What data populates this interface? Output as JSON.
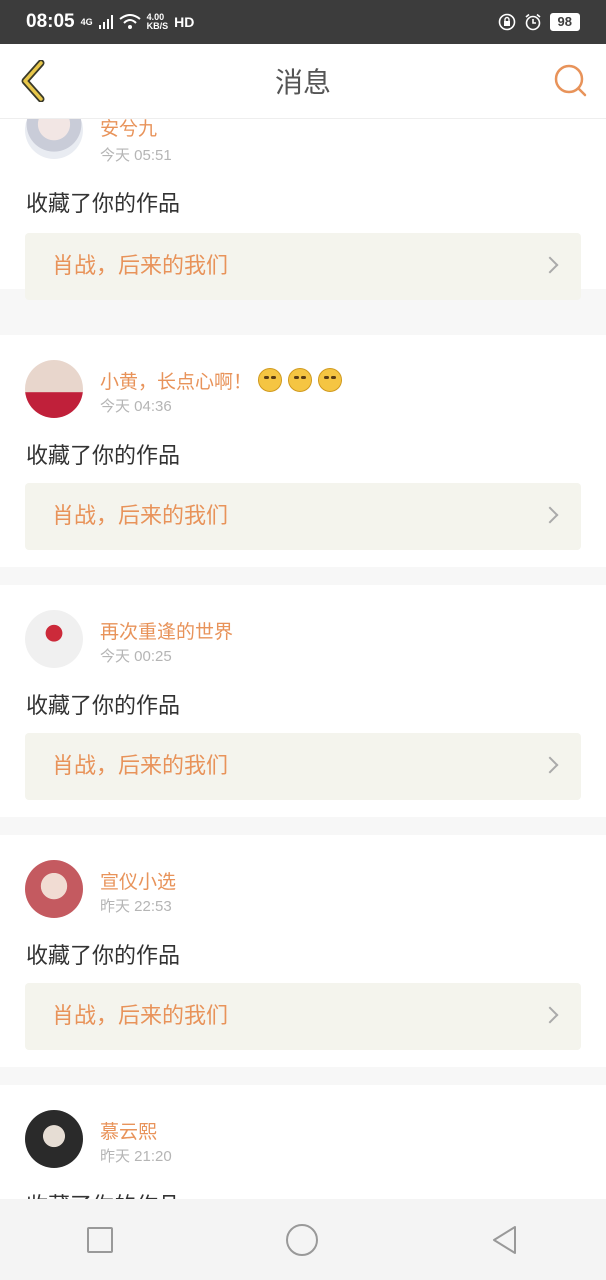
{
  "status_bar": {
    "time": "08:05",
    "network": "4G",
    "speed_value": "4.00",
    "speed_unit": "KB/S",
    "hd": "HD",
    "battery": "98"
  },
  "header": {
    "title": "消息"
  },
  "messages": [
    {
      "name": "安兮九",
      "time": "今天 05:51",
      "action": "收藏了你的作品",
      "work": "肖战，后来的我们"
    },
    {
      "name": "小黄，长点心啊！",
      "time": "今天 04:36",
      "action": "收藏了你的作品",
      "work": "肖战，后来的我们"
    },
    {
      "name": "再次重逢的世界",
      "time": "今天 00:25",
      "action": "收藏了你的作品",
      "work": "肖战，后来的我们"
    },
    {
      "name": "宣仪小选",
      "time": "昨天 22:53",
      "action": "收藏了你的作品",
      "work": "肖战，后来的我们"
    },
    {
      "name": "慕云熙",
      "time": "昨天 21:20",
      "action": "收藏了你的作品"
    }
  ],
  "colors": {
    "accent": "#e8935a",
    "work_bg": "#f4f4ed",
    "status_bar": "#3c3c3c"
  },
  "icons": {
    "back": "chevron-left-icon",
    "search": "search-icon",
    "work_arrow": "chevron-right-icon",
    "nav_recents": "square-icon",
    "nav_home": "circle-icon",
    "nav_back": "triangle-back-icon"
  }
}
